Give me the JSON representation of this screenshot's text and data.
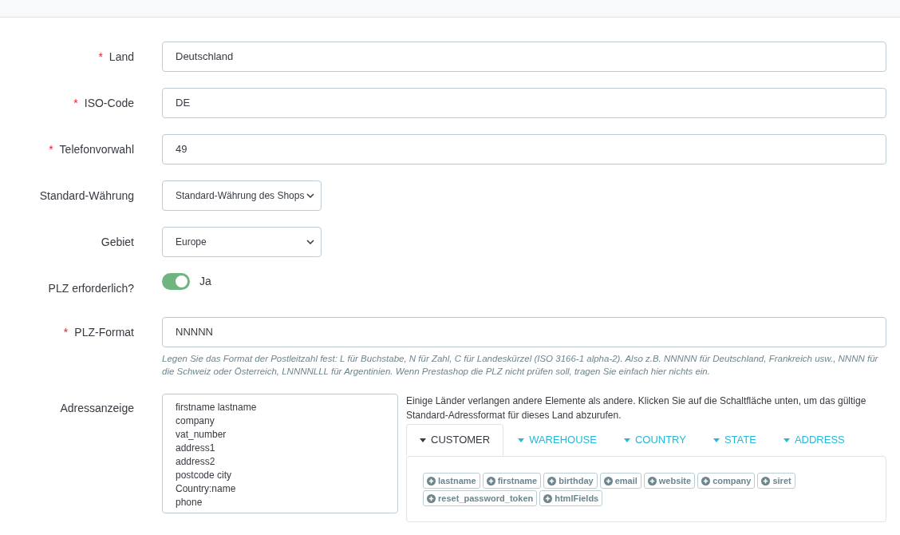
{
  "fields": [
    {
      "kind": "text",
      "label": "Land",
      "required_mark": "*",
      "value": "Deutschland"
    },
    {
      "kind": "text",
      "label": "ISO-Code",
      "required_mark": "*",
      "value": "DE"
    },
    {
      "kind": "text",
      "label": "Telefonvorwahl",
      "required_mark": "*",
      "value": "49"
    },
    {
      "kind": "select",
      "label": "Standard-Währung",
      "value": "Standard-Währung des Shops"
    },
    {
      "kind": "select",
      "label": "Gebiet",
      "value": "Europe"
    },
    {
      "kind": "switch",
      "label": "PLZ erforderlich?",
      "on": true,
      "value": "Ja"
    },
    {
      "kind": "text",
      "label": "PLZ-Format",
      "required_mark": "*",
      "value": "NNNNN",
      "help": "Legen Sie das Format der Postleitzahl fest: L für Buchstabe, N für Zahl, C für Landeskürzel (ISO 3166-1 alpha-2). Also z.B. NNNNN für Deutschland, Frankreich usw., NNNN für die Schweiz oder Österreich, LNNNNLLL für Argentinien. Wenn Prestashop die PLZ nicht prüfen soll, tragen Sie einfach hier nichts ein."
    }
  ],
  "address": {
    "label": "Adressanzeige",
    "lines": [
      "firstname lastname",
      "company",
      "vat_number",
      "address1",
      "address2",
      "postcode city",
      "Country:name",
      "phone"
    ],
    "hint": "Einige Länder verlangen andere Elemente als andere. Klicken Sie auf die Schaltfläche unten, um das gültige Standard-Adressformat für dieses Land abzurufen.",
    "tabs": [
      {
        "label": "CUSTOMER",
        "selected": true
      },
      {
        "label": "WAREHOUSE",
        "selected": false
      },
      {
        "label": "COUNTRY",
        "selected": false
      },
      {
        "label": "STATE",
        "selected": false
      },
      {
        "label": "ADDRESS",
        "selected": false
      }
    ],
    "tags": [
      "lastname",
      "firstname",
      "birthday",
      "email",
      "website",
      "company",
      "siret",
      "reset_password_token",
      "htmlFields"
    ]
  }
}
